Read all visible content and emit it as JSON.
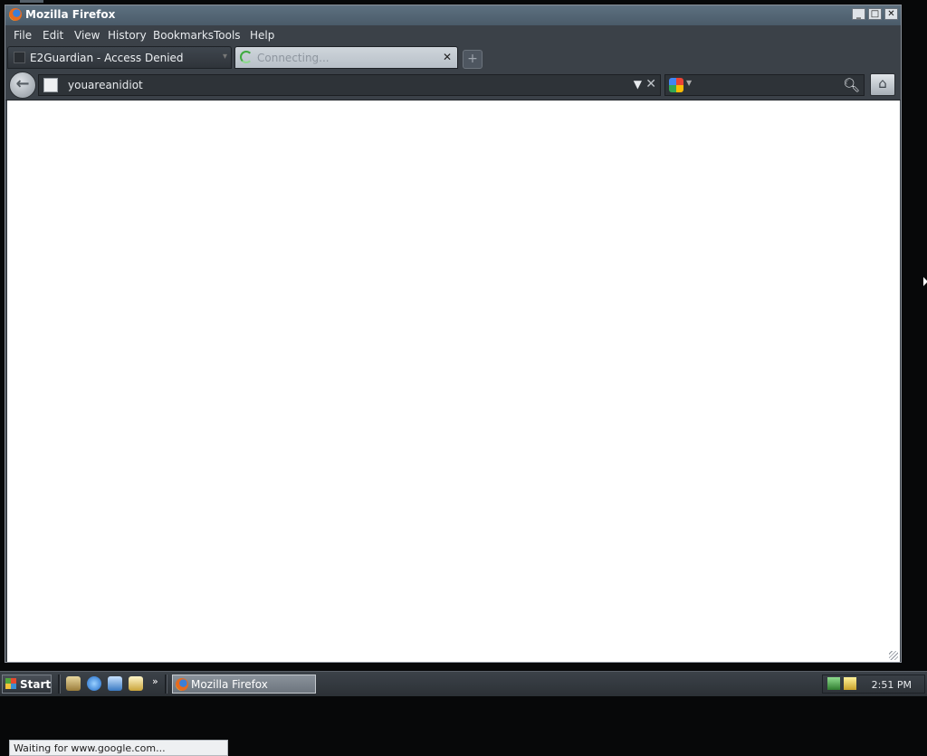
{
  "window": {
    "title": "Mozilla Firefox"
  },
  "menubar": {
    "items": [
      "File",
      "Edit",
      "View",
      "History",
      "Bookmarks",
      "Tools",
      "Help"
    ]
  },
  "tabs": [
    {
      "label": "E2Guardian - Access Denied",
      "active": false
    },
    {
      "label": "Connecting...",
      "active": true
    }
  ],
  "nav": {
    "url": "youareanidiot",
    "search_value": ""
  },
  "status": {
    "text": "Waiting for www.google.com..."
  },
  "taskbar": {
    "start_label": "Start",
    "task_label": "Mozilla Firefox",
    "clock": "2:51 PM"
  },
  "icons": {
    "app": "firefox-icon",
    "back": "back-arrow-icon",
    "home": "home-icon",
    "search": "magnifier-icon",
    "engine": "google-icon"
  },
  "colors": {
    "chrome": "#3b4148",
    "titlebar": "#5d7080",
    "content": "#ffffff"
  }
}
